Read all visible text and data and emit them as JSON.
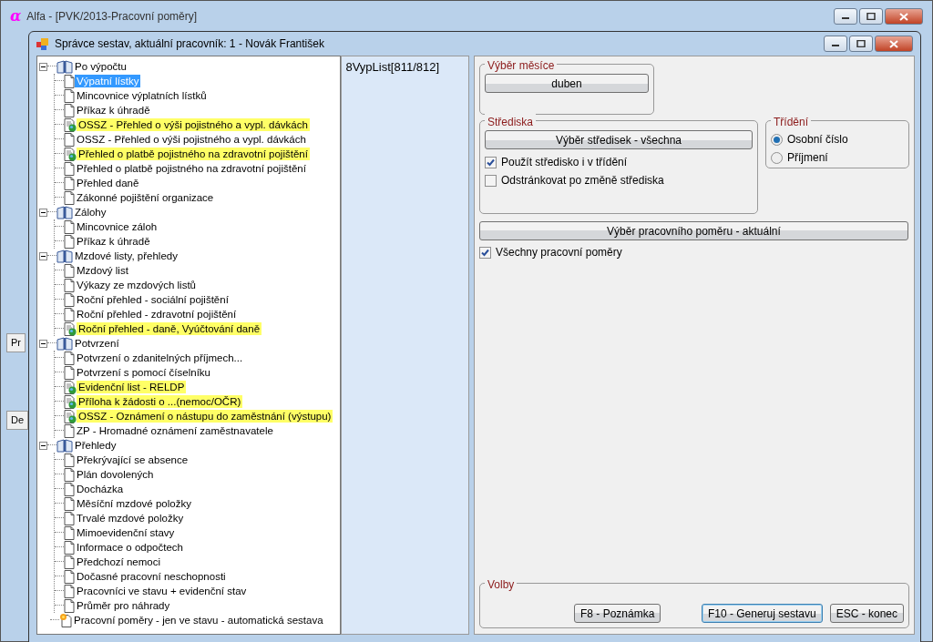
{
  "app_window": {
    "logo": "α",
    "title": "Alfa - [PVK/2013-Pracovní poměry]",
    "background_fragments": [
      "Pr",
      "De"
    ]
  },
  "dialog": {
    "title": "Správce sestav, aktuální pracovník: 1 - Novák František"
  },
  "tree": [
    {
      "label": "Po výpočtu",
      "kind": "folder",
      "expanded": true,
      "children": [
        {
          "label": "Výpatní lístky",
          "kind": "page",
          "highlighted": false,
          "selected": true
        },
        {
          "label": "Mincovnice výplatních lístků",
          "kind": "page",
          "highlighted": false,
          "selected": false
        },
        {
          "label": "Příkaz k úhradě",
          "kind": "page",
          "highlighted": false,
          "selected": false
        },
        {
          "label": "OSSZ - Přehled o výši pojistného a vypl. dávkách",
          "kind": "web",
          "highlighted": true,
          "selected": false
        },
        {
          "label": "OSSZ - Přehled o výši pojistného a vypl. dávkách",
          "kind": "page",
          "highlighted": false,
          "selected": false
        },
        {
          "label": "Přehled o platbě pojistného na zdravotní pojištění",
          "kind": "web",
          "highlighted": true,
          "selected": false
        },
        {
          "label": "Přehled o platbě pojistného na zdravotní pojištění",
          "kind": "page",
          "highlighted": false,
          "selected": false
        },
        {
          "label": "Přehled daně",
          "kind": "page",
          "highlighted": false,
          "selected": false
        },
        {
          "label": "Zákonné pojištění organizace",
          "kind": "page",
          "highlighted": false,
          "selected": false
        }
      ]
    },
    {
      "label": "Zálohy",
      "kind": "folder",
      "expanded": true,
      "children": [
        {
          "label": "Mincovnice záloh",
          "kind": "page",
          "highlighted": false,
          "selected": false
        },
        {
          "label": "Příkaz k úhradě",
          "kind": "page",
          "highlighted": false,
          "selected": false
        }
      ]
    },
    {
      "label": "Mzdové listy, přehledy",
      "kind": "folder",
      "expanded": true,
      "children": [
        {
          "label": "Mzdový list",
          "kind": "page",
          "highlighted": false,
          "selected": false
        },
        {
          "label": "Výkazy ze mzdových listů",
          "kind": "page",
          "highlighted": false,
          "selected": false
        },
        {
          "label": "Roční přehled - sociální pojištění",
          "kind": "page",
          "highlighted": false,
          "selected": false
        },
        {
          "label": "Roční přehled - zdravotní pojištění",
          "kind": "page",
          "highlighted": false,
          "selected": false
        },
        {
          "label": "Roční přehled - daně, Vyúčtování daně",
          "kind": "web",
          "highlighted": true,
          "selected": false
        }
      ]
    },
    {
      "label": "Potvrzení",
      "kind": "folder",
      "expanded": true,
      "children": [
        {
          "label": "Potvrzení o zdanitelných příjmech...",
          "kind": "page",
          "highlighted": false,
          "selected": false
        },
        {
          "label": "Potvrzení s pomocí číselníku",
          "kind": "page",
          "highlighted": false,
          "selected": false
        },
        {
          "label": "Evidenční list - RELDP",
          "kind": "web",
          "highlighted": true,
          "selected": false
        },
        {
          "label": "Příloha k žádosti o ...(nemoc/OČR)",
          "kind": "web",
          "highlighted": true,
          "selected": false
        },
        {
          "label": "OSSZ - Oznámení o nástupu do zaměstnání (výstupu)",
          "kind": "web",
          "highlighted": true,
          "selected": false
        },
        {
          "label": "ZP - Hromadné oznámení zaměstnavatele",
          "kind": "page",
          "highlighted": false,
          "selected": false
        }
      ]
    },
    {
      "label": "Přehledy",
      "kind": "folder",
      "expanded": true,
      "children": [
        {
          "label": "Překrývající se absence",
          "kind": "page",
          "highlighted": false,
          "selected": false
        },
        {
          "label": "Plán dovolených",
          "kind": "page",
          "highlighted": false,
          "selected": false
        },
        {
          "label": "Docházka",
          "kind": "page",
          "highlighted": false,
          "selected": false
        },
        {
          "label": "Měsíční mzdové položky",
          "kind": "page",
          "highlighted": false,
          "selected": false
        },
        {
          "label": "Trvalé mzdové položky",
          "kind": "page",
          "highlighted": false,
          "selected": false
        },
        {
          "label": "Mimoevidenční stavy",
          "kind": "page",
          "highlighted": false,
          "selected": false
        },
        {
          "label": "Informace o odpočtech",
          "kind": "page",
          "highlighted": false,
          "selected": false
        },
        {
          "label": "Předchozí nemoci",
          "kind": "page",
          "highlighted": false,
          "selected": false
        },
        {
          "label": "Dočasné pracovní neschopnosti",
          "kind": "page",
          "highlighted": false,
          "selected": false
        },
        {
          "label": "Pracovníci ve stavu + evidenční stav",
          "kind": "page",
          "highlighted": false,
          "selected": false
        },
        {
          "label": "Průměr pro náhrady",
          "kind": "page",
          "highlighted": false,
          "selected": false
        }
      ]
    },
    {
      "label": "Pracovní poměry - jen ve stavu - automatická sestava",
      "kind": "auto"
    }
  ],
  "report_list": [
    "8VypList[811/812]"
  ],
  "month_group": {
    "legend": "Výběr měsíce",
    "button": "duben"
  },
  "centers_group": {
    "legend": "Střediska",
    "button": "Výběr středisek - všechna",
    "checkboxes": [
      {
        "label": "Použít středisko i v třídění",
        "checked": true
      },
      {
        "label": "Odstránkovat po změně střediska",
        "checked": false
      }
    ]
  },
  "sort_group": {
    "legend": "Třídění",
    "options": [
      {
        "label": "Osobní číslo",
        "selected": true
      },
      {
        "label": "Příjmení",
        "selected": false
      }
    ]
  },
  "employment_button": "Výběr pracovního poměru - aktuální",
  "employment_checkbox": {
    "label": "Všechny pracovní poměry",
    "checked": true
  },
  "options_group": {
    "legend": "Volby",
    "buttons": [
      {
        "label": "F8 - Poznámka",
        "default": false
      },
      {
        "label": "F10 - Generuj sestavu",
        "default": true
      },
      {
        "label": "ESC - konec",
        "default": false
      }
    ]
  }
}
